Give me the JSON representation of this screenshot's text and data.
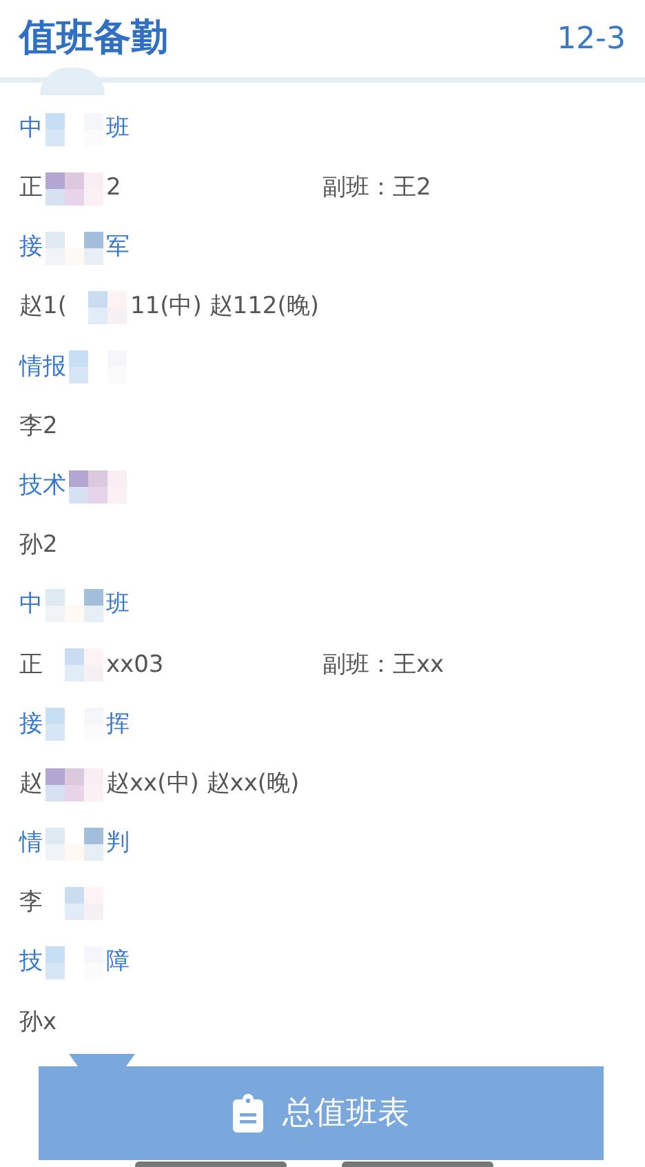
{
  "header": {
    "title": "值班备勤",
    "date": "12-3"
  },
  "sections": [
    {
      "title": [
        {
          "kind": "text",
          "text": "中"
        },
        {
          "kind": "mosaic"
        },
        {
          "kind": "text",
          "text": "班"
        }
      ],
      "lines": [
        {
          "parts": [
            {
              "kind": "text",
              "text": "正"
            },
            {
              "kind": "mosaic"
            },
            {
              "kind": "text",
              "text": "2"
            }
          ],
          "deputy": "副班：王2"
        }
      ]
    },
    {
      "title": [
        {
          "kind": "text",
          "text": "接"
        },
        {
          "kind": "mosaic"
        },
        {
          "kind": "text",
          "text": "军"
        }
      ],
      "lines": [
        {
          "parts": [
            {
              "kind": "text",
              "text": "赵1("
            },
            {
              "kind": "mosaic"
            },
            {
              "kind": "text",
              "text": "11(中) 赵112(晚)"
            }
          ]
        }
      ]
    },
    {
      "title": [
        {
          "kind": "text",
          "text": "情报"
        },
        {
          "kind": "mosaic"
        }
      ],
      "lines": [
        {
          "parts": [
            {
              "kind": "text",
              "text": "李2"
            }
          ]
        }
      ]
    },
    {
      "title": [
        {
          "kind": "text",
          "text": "技术"
        },
        {
          "kind": "mosaic"
        }
      ],
      "lines": [
        {
          "parts": [
            {
              "kind": "text",
              "text": "孙2"
            }
          ]
        }
      ]
    },
    {
      "title": [
        {
          "kind": "text",
          "text": "中"
        },
        {
          "kind": "mosaic"
        },
        {
          "kind": "text",
          "text": "班"
        }
      ],
      "lines": [
        {
          "parts": [
            {
              "kind": "text",
              "text": "正"
            },
            {
              "kind": "mosaic"
            },
            {
              "kind": "text",
              "text": "xx03"
            }
          ],
          "deputy": "副班：王xx"
        }
      ]
    },
    {
      "title": [
        {
          "kind": "text",
          "text": "接"
        },
        {
          "kind": "mosaic"
        },
        {
          "kind": "text",
          "text": "挥"
        }
      ],
      "lines": [
        {
          "parts": [
            {
              "kind": "text",
              "text": "赵"
            },
            {
              "kind": "mosaic"
            },
            {
              "kind": "text",
              "text": "赵xx(中) 赵xx(晚)"
            }
          ]
        }
      ]
    },
    {
      "title": [
        {
          "kind": "text",
          "text": "情"
        },
        {
          "kind": "mosaic"
        },
        {
          "kind": "text",
          "text": "判"
        }
      ],
      "lines": [
        {
          "parts": [
            {
              "kind": "text",
              "text": "李"
            },
            {
              "kind": "mosaic"
            }
          ]
        }
      ]
    },
    {
      "title": [
        {
          "kind": "text",
          "text": "技"
        },
        {
          "kind": "mosaic"
        },
        {
          "kind": "text",
          "text": "障"
        }
      ],
      "lines": [
        {
          "parts": [
            {
              "kind": "text",
              "text": "孙x"
            }
          ]
        }
      ]
    }
  ],
  "button": {
    "label": "总值班表"
  }
}
